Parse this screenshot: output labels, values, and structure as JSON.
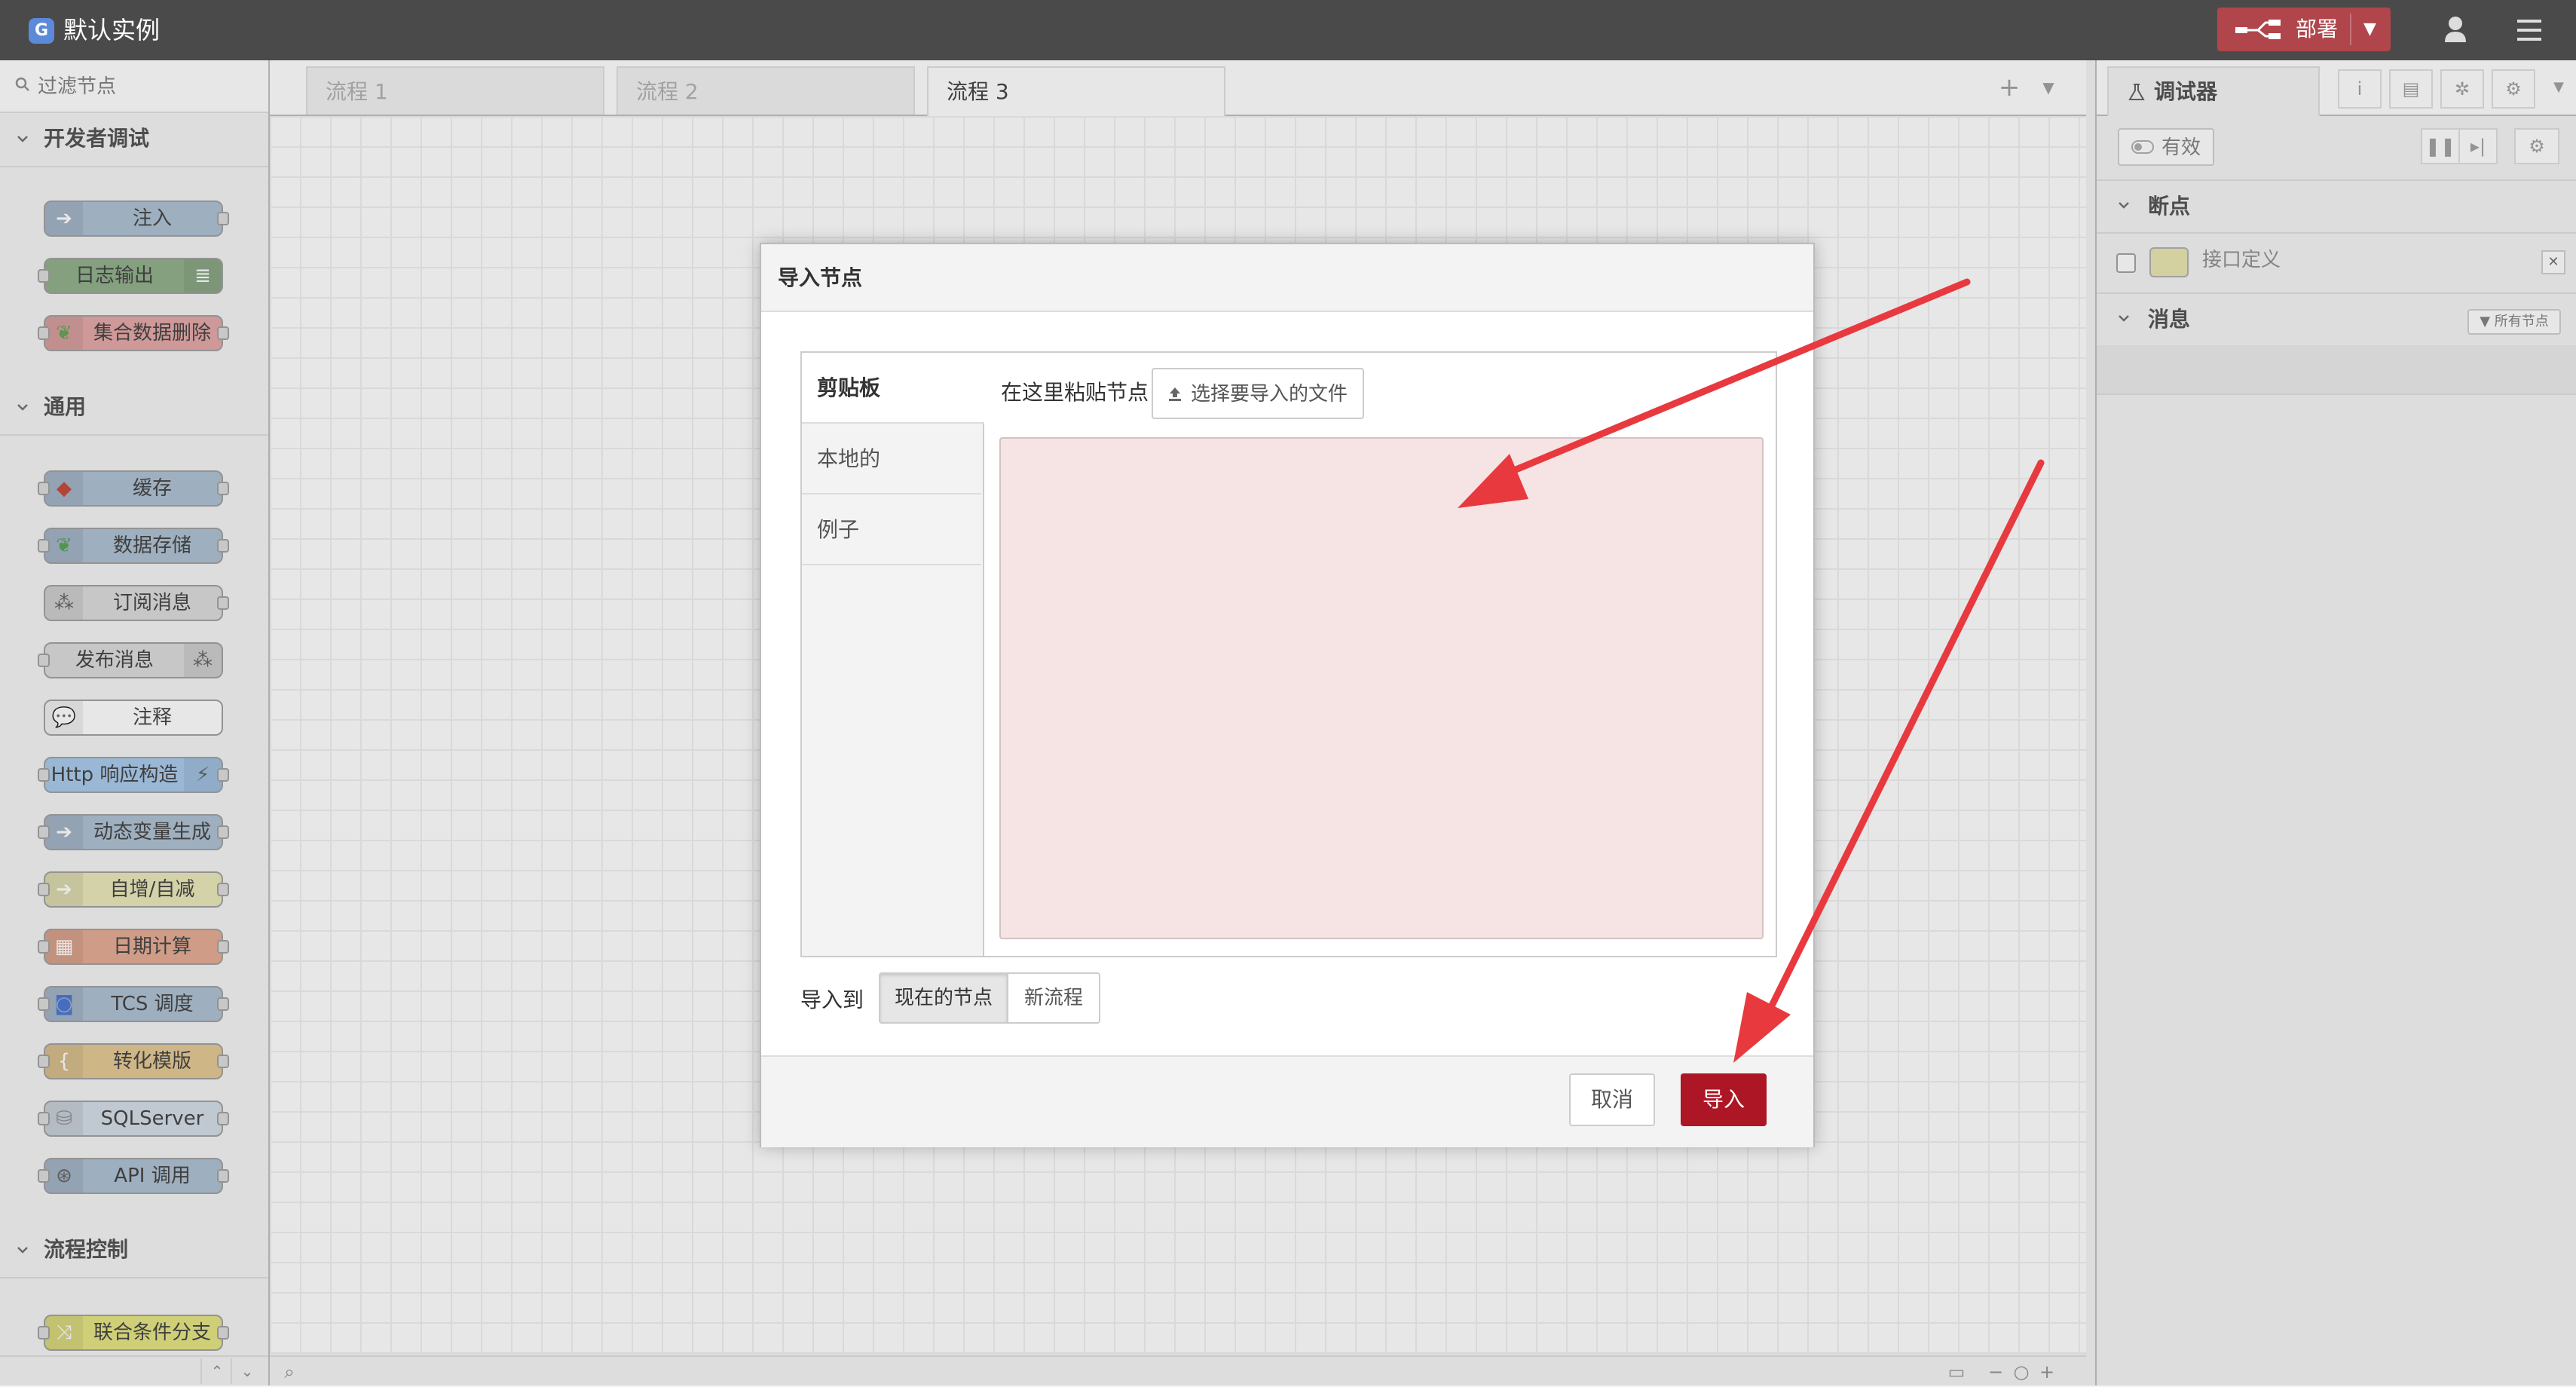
{
  "app": {
    "title": "默认实例",
    "logo_letter": "G"
  },
  "header": {
    "deploy_label": "部署",
    "user_icon": "user-icon",
    "menu_icon": "hamburger-icon"
  },
  "palette": {
    "filter_placeholder": "过滤节点",
    "categories": [
      {
        "label": "开发者调试",
        "nodes": [
          "注入",
          "日志输出",
          "集合数据删除"
        ]
      },
      {
        "label": "通用",
        "nodes": [
          "缓存",
          "数据存储",
          "订阅消息",
          "发布消息",
          "注释",
          "Http 响应构造",
          "动态变量生成",
          "自增/自减",
          "日期计算",
          "TCS 调度",
          "转化模版",
          "SQLServer",
          "API 调用"
        ]
      },
      {
        "label": "流程控制",
        "nodes": [
          "联合条件分支"
        ]
      }
    ],
    "node_colors": {
      "inject": "#a6bbcf",
      "debug": "#87a980",
      "delete": "#e2a0a0",
      "cache": "#a6bbcf",
      "store": "#a6bbcf",
      "subscribe": "#d8d8d8",
      "publish": "#d8d8d8",
      "comment": "#ffffff",
      "http": "#a1c6ea",
      "dynvar": "#a6bbcf",
      "incr": "#e7e6b2",
      "date": "#e2a48a",
      "tcs": "#a6bbcf",
      "template": "#e2c48a",
      "sql": "#d0dae4",
      "api": "#a6bbcf",
      "switch": "#e2e278"
    }
  },
  "workspace": {
    "tabs": [
      "流程 1",
      "流程 2",
      "流程 3"
    ],
    "active_tab": 2
  },
  "sidebar": {
    "tab_label": "调试器",
    "enabled_label": "有效",
    "breakpoints_label": "断点",
    "breakpoint_item": "接口定义",
    "messages_label": "消息",
    "filter_label": "所有节点"
  },
  "dialog": {
    "title": "导入节点",
    "tabs": [
      "剪贴板",
      "本地的",
      "例子"
    ],
    "active_tab": 0,
    "paste_label": "在这里粘贴节点",
    "file_button": "选择要导入的文件",
    "paste_value": "",
    "import_to_label": "导入到",
    "import_to_options": [
      "现在的节点",
      "新流程"
    ],
    "import_to_selected": 0,
    "cancel": "取消",
    "import": "导入",
    "accent": "#ad1625"
  },
  "annotations": {
    "arrow_color": "#e8393f"
  }
}
